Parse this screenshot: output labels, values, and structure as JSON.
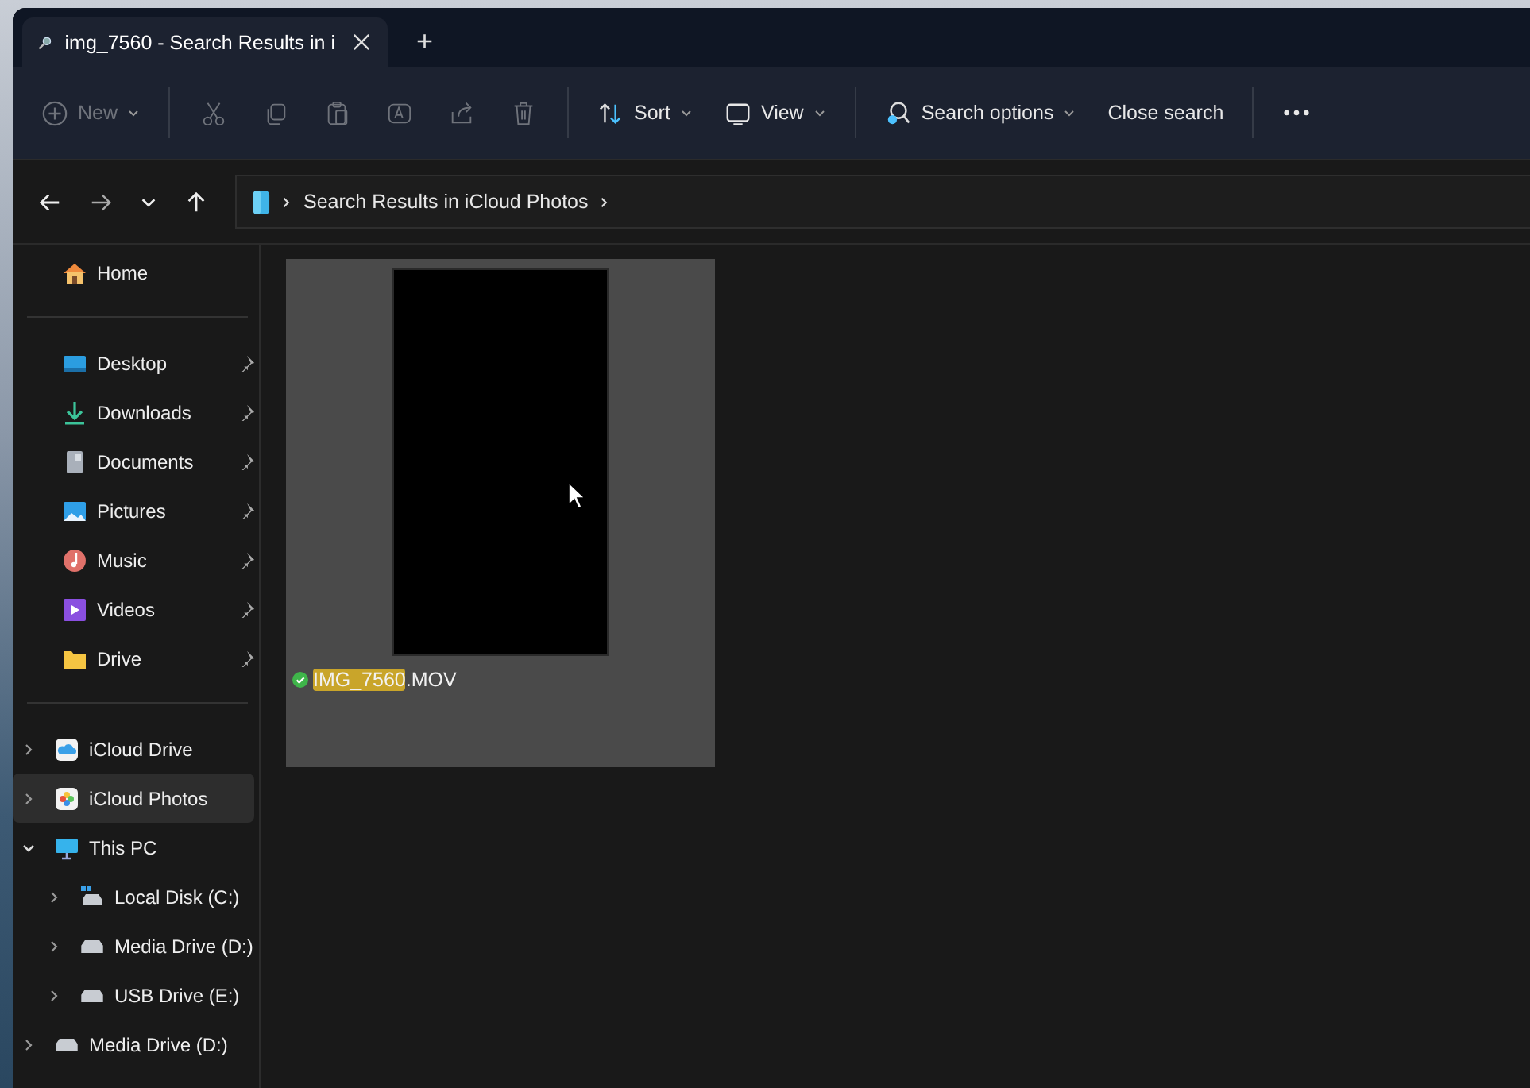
{
  "tab": {
    "title": "img_7560 - Search Results in i",
    "selected": true
  },
  "new_tab": {
    "label": "+"
  },
  "toolbar": [
    {
      "kind": "new",
      "label": "New",
      "disabled": true
    },
    {
      "kind": "cut",
      "disabled": true
    },
    {
      "kind": "copy",
      "disabled": true
    },
    {
      "kind": "paste",
      "disabled": true
    },
    {
      "kind": "rename",
      "disabled": true
    },
    {
      "kind": "share",
      "disabled": true
    },
    {
      "kind": "delete",
      "disabled": true
    },
    {
      "kind": "sort",
      "label": "Sort",
      "disabled": false
    },
    {
      "kind": "view",
      "label": "View",
      "disabled": false
    },
    {
      "kind": "search-options",
      "label": "Search options",
      "disabled": false
    },
    {
      "kind": "close-search",
      "label": "Close search",
      "disabled": false
    },
    {
      "kind": "more",
      "disabled": false
    }
  ],
  "address": {
    "path": "Search Results in iCloud Photos"
  },
  "sidebar": {
    "quick": [
      {
        "kind": "home",
        "label": "Home"
      }
    ],
    "pinned": [
      {
        "kind": "desktop",
        "label": "Desktop",
        "pinned": true
      },
      {
        "kind": "downloads",
        "label": "Downloads",
        "pinned": true
      },
      {
        "kind": "documents",
        "label": "Documents",
        "pinned": true
      },
      {
        "kind": "pictures",
        "label": "Pictures",
        "pinned": true
      },
      {
        "kind": "music",
        "label": "Music",
        "pinned": true
      },
      {
        "kind": "videos",
        "label": "Videos",
        "pinned": true
      },
      {
        "kind": "folder",
        "label": "Drive",
        "pinned": true
      }
    ],
    "tree": [
      {
        "kind": "cloud-drive",
        "label": "iCloud Drive",
        "selected": false,
        "expanded": false
      },
      {
        "kind": "cloud-photos",
        "label": "iCloud Photos",
        "selected": true,
        "expanded": false
      },
      {
        "kind": "pc",
        "label": "This PC",
        "selected": false,
        "expanded": true,
        "children": [
          {
            "kind": "system-disk",
            "label": "Local Disk (C:)",
            "selected": false,
            "expanded": false
          },
          {
            "kind": "disk",
            "label": "Media Drive (D:)",
            "selected": false,
            "expanded": false
          },
          {
            "kind": "disk",
            "label": "USB Drive (E:)",
            "selected": false,
            "expanded": false
          }
        ]
      },
      {
        "kind": "disk",
        "label": "Media Drive (D:)",
        "selected": false,
        "expanded": false
      }
    ]
  },
  "files": [
    {
      "name_match": "IMG_7560",
      "name_rest": ".MOV",
      "selected": true,
      "synced": true
    }
  ]
}
